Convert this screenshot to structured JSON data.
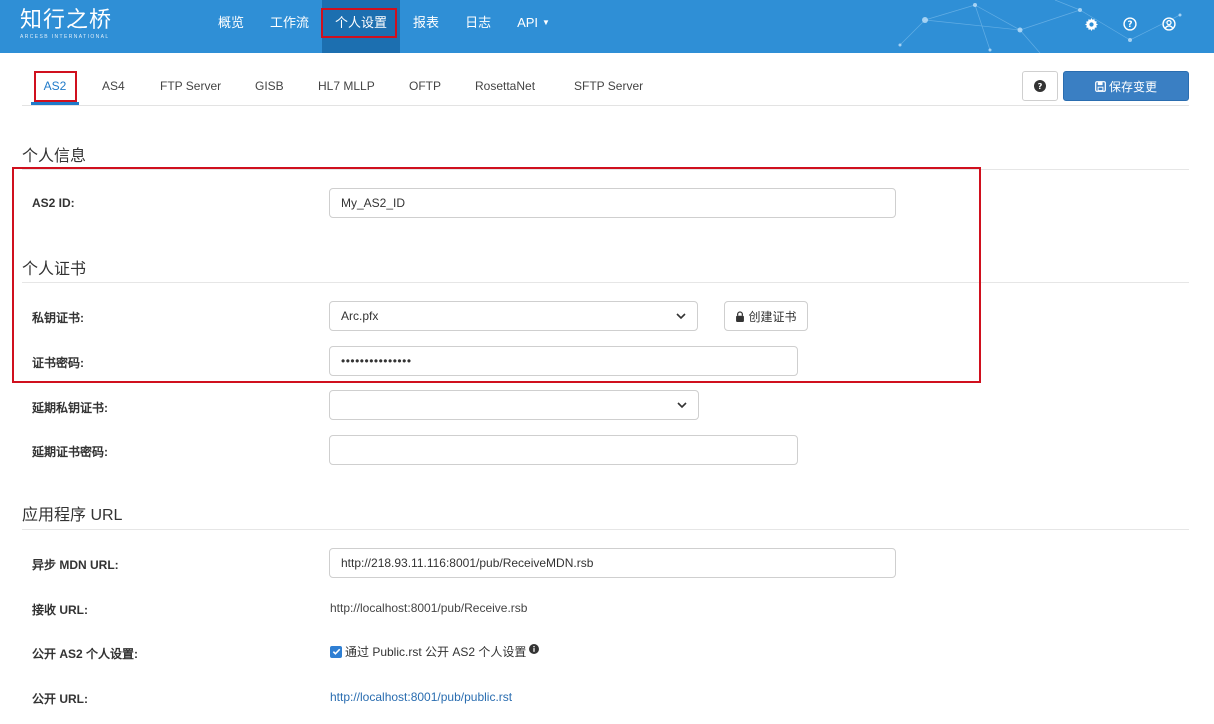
{
  "app": {
    "logo_text": "知行之桥",
    "logo_subtext": "ARCESB INTERNATIONAL"
  },
  "nav": {
    "items": [
      {
        "label": "概览"
      },
      {
        "label": "工作流"
      },
      {
        "label": "个人设置"
      },
      {
        "label": "报表"
      },
      {
        "label": "日志"
      },
      {
        "label": "API"
      }
    ],
    "active": "个人设置"
  },
  "top_icons": [
    "gear-icon",
    "question-circle-icon",
    "user-circle-icon"
  ],
  "tabs": {
    "items": [
      {
        "label": "AS2"
      },
      {
        "label": "AS4"
      },
      {
        "label": "FTP Server"
      },
      {
        "label": "GISB"
      },
      {
        "label": "HL7 MLLP"
      },
      {
        "label": "OFTP"
      },
      {
        "label": "RosettaNet"
      },
      {
        "label": "SFTP Server"
      }
    ],
    "active": "AS2"
  },
  "toolbar": {
    "save_label": "保存变更"
  },
  "personal_info": {
    "title": "个人信息",
    "as2_id_label": "AS2 ID:",
    "as2_id_value": "My_AS2_ID"
  },
  "personal_cert": {
    "title": "个人证书",
    "private_cert_label": "私钥证书:",
    "private_cert_value": "Arc.pfx",
    "create_cert_label": "创建证书",
    "cert_password_label": "证书密码:",
    "cert_password_value": "•••••••••••••••",
    "deferred_cert_label": "延期私钥证书:",
    "deferred_cert_value": "",
    "deferred_password_label": "延期证书密码:",
    "deferred_password_value": ""
  },
  "app_url": {
    "title": "应用程序 URL",
    "async_mdn_label": "异步 MDN URL:",
    "async_mdn_value": "http://218.93.11.116:8001/pub/ReceiveMDN.rsb",
    "receive_label": "接收 URL:",
    "receive_value": "http://localhost:8001/pub/Receive.rsb",
    "public_settings_label": "公开 AS2 个人设置:",
    "public_settings_checkbox": "通过 Public.rst 公开 AS2 个人设置",
    "public_settings_checked": true,
    "public_url_label": "公开 URL:",
    "public_url_value": "http://localhost:8001/pub/public.rst"
  },
  "colors": {
    "header_bg": "#2f8fd6",
    "accent": "#1f7ac9",
    "annotation_red": "#d0101e",
    "save_button": "#3a7fc3"
  }
}
